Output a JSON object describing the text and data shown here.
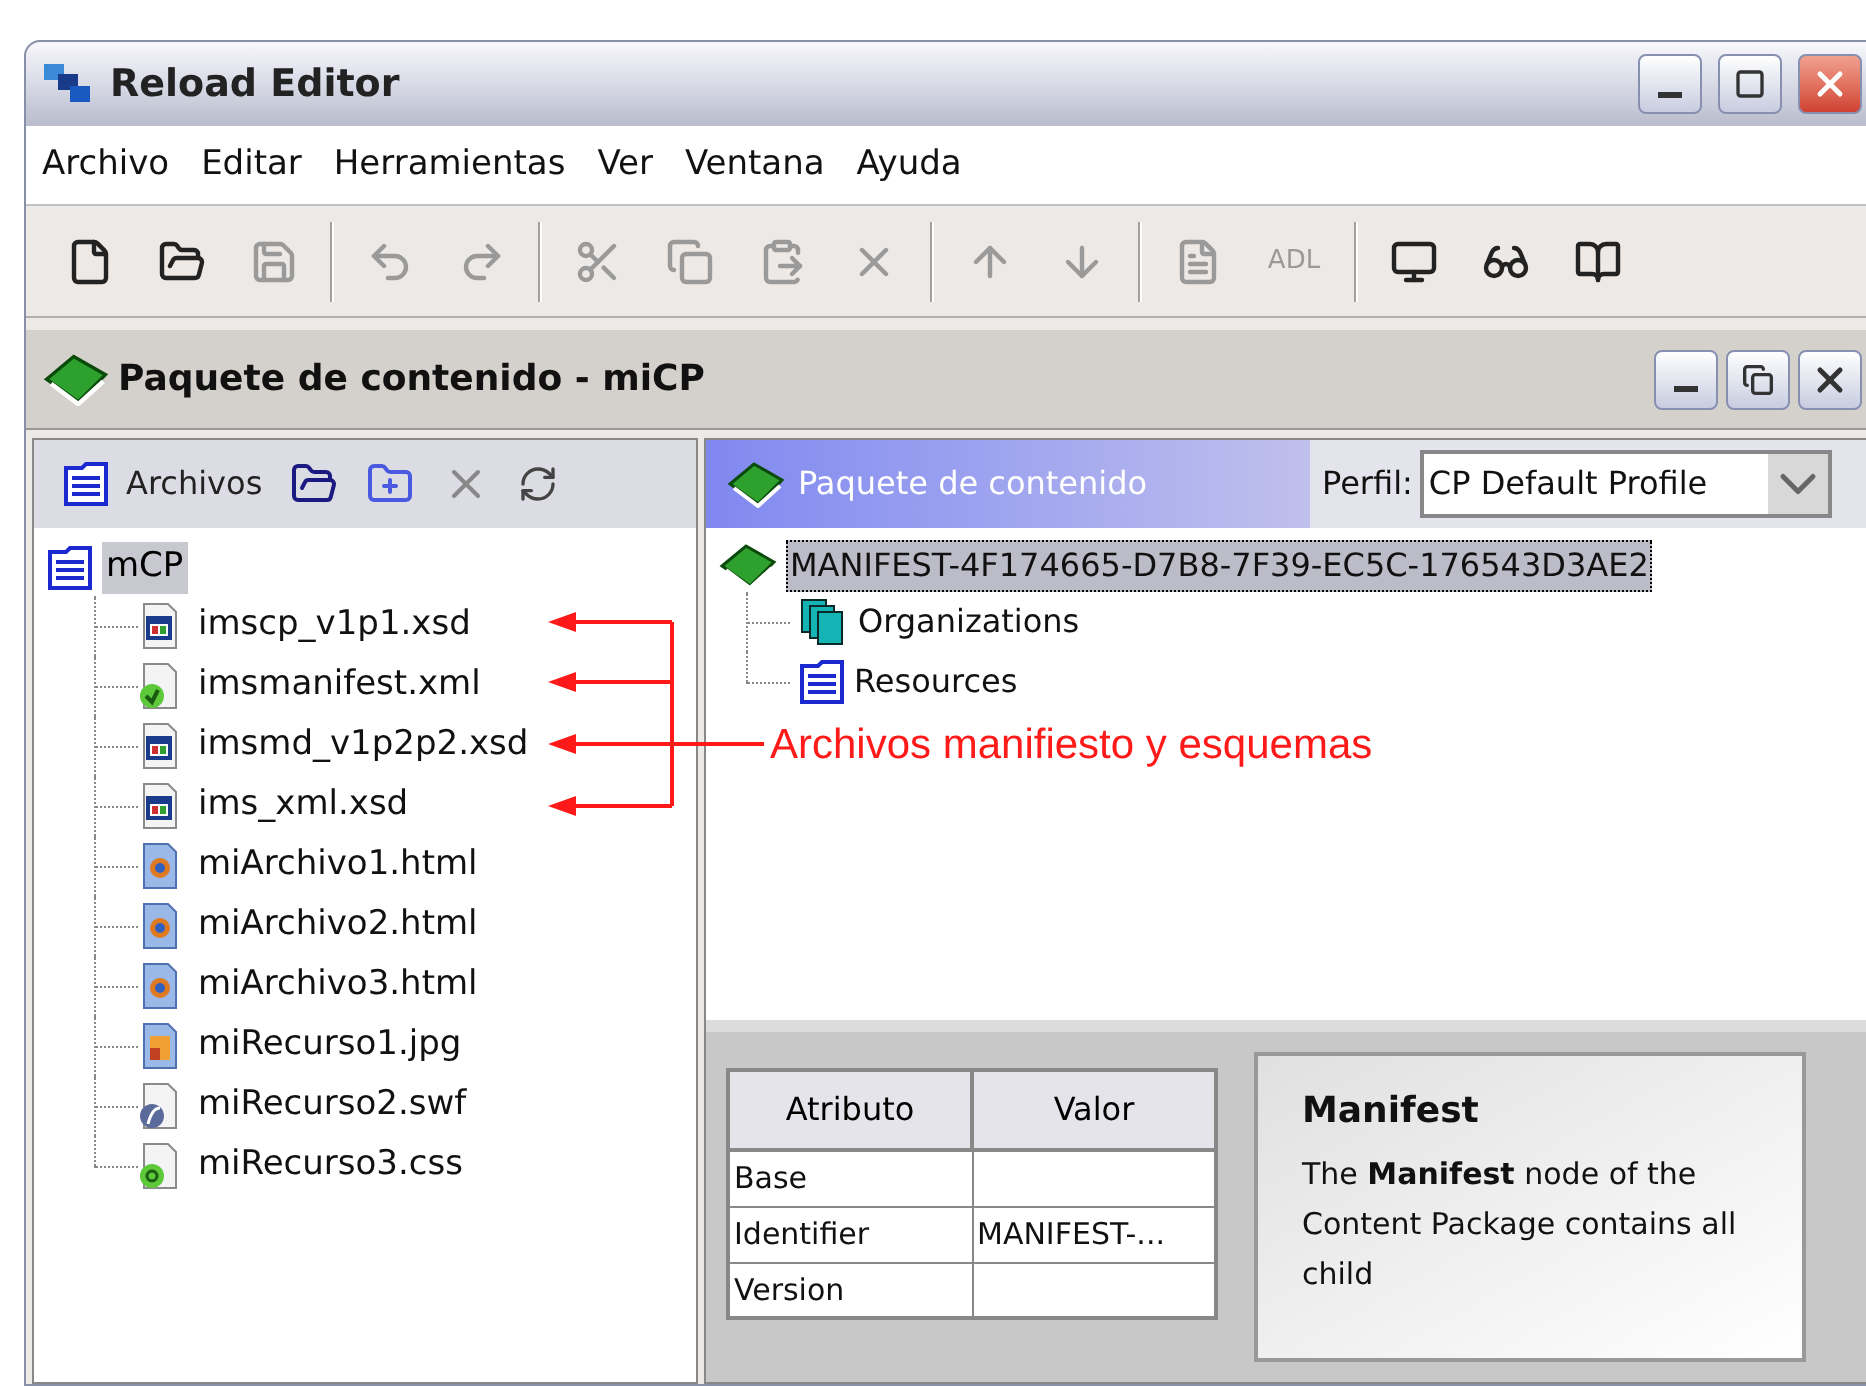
{
  "window": {
    "title": "Reload Editor"
  },
  "menu": [
    "Archivo",
    "Editar",
    "Herramientas",
    "Ver",
    "Ventana",
    "Ayuda"
  ],
  "toolbar": [
    [
      {
        "disabled": false
      },
      {
        "disabled": false
      },
      {
        "disabled": true
      }
    ],
    [
      {
        "disabled": true
      },
      {
        "disabled": true
      }
    ],
    [
      {
        "disabled": true
      },
      {
        "disabled": true
      },
      {
        "disabled": true
      },
      {
        "disabled": true
      }
    ],
    [
      {
        "disabled": true
      },
      {
        "disabled": true
      }
    ],
    [
      {
        "disabled": true
      },
      {
        "disabled": true,
        "label": "ADL"
      }
    ],
    [
      {
        "disabled": false
      },
      {
        "disabled": false
      },
      {
        "disabled": false
      }
    ]
  ],
  "document": {
    "title": "Paquete de contenido - miCP"
  },
  "files_panel": {
    "title": "Archivos",
    "root": {
      "label": "mCP",
      "selected": true,
      "children": [
        {
          "label": "imscp_v1p1.xsd",
          "kind": "schema"
        },
        {
          "label": "imsmanifest.xml",
          "kind": "xml"
        },
        {
          "label": "imsmd_v1p2p2.xsd",
          "kind": "schema"
        },
        {
          "label": "ims_xml.xsd",
          "kind": "schema"
        },
        {
          "label": "miArchivo1.html",
          "kind": "html"
        },
        {
          "label": "miArchivo2.html",
          "kind": "html"
        },
        {
          "label": "miArchivo3.html",
          "kind": "html"
        },
        {
          "label": "miRecurso1.jpg",
          "kind": "image"
        },
        {
          "label": "miRecurso2.swf",
          "kind": "flash"
        },
        {
          "label": "miRecurso3.css",
          "kind": "css"
        }
      ]
    }
  },
  "package_panel": {
    "title": "Paquete de contenido",
    "profile_label": "Perfil:",
    "profile": "CP Default Profile",
    "root": {
      "label": "MANIFEST-4F174665-D7B8-7F39-EC5C-176543D3AE2",
      "selected": true,
      "children": [
        {
          "label": "Organizations",
          "kind": "organizations"
        },
        {
          "label": "Resources",
          "kind": "resources"
        }
      ]
    }
  },
  "annotation": {
    "text": "Archivos manifiesto y esquemas"
  },
  "attributes": {
    "columns": [
      "Atributo",
      "Valor"
    ],
    "rows": [
      [
        "Base",
        ""
      ],
      [
        "Identifier",
        "MANIFEST-..."
      ],
      [
        "Version",
        ""
      ]
    ]
  },
  "help": {
    "title": "Manifest",
    "text": "The **Manifest** node of the Content Package contains all child"
  }
}
